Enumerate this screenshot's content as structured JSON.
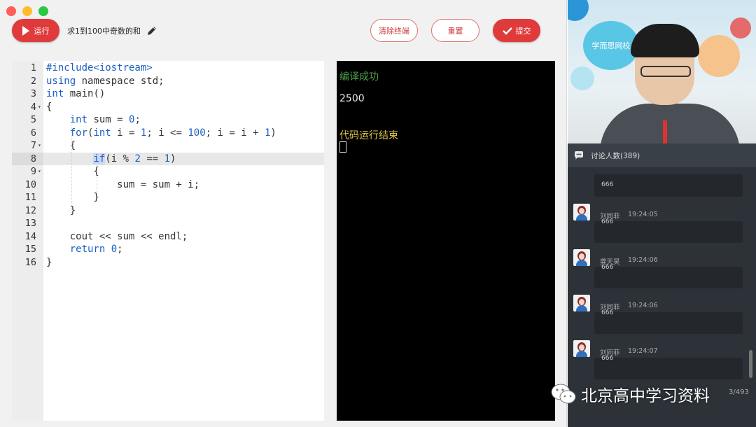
{
  "toolbar": {
    "run_label": "运行",
    "task_title": "求1到100中奇数的和",
    "clear_label": "清除终端",
    "reset_label": "重置",
    "submit_label": "提交"
  },
  "editor": {
    "active_line": 8,
    "lines": [
      {
        "n": "1",
        "fold": false,
        "html": "<span class='pp'>#include&lt;iostream&gt;</span>"
      },
      {
        "n": "2",
        "fold": false,
        "html": "<span class='kw'>using</span> namespace std;"
      },
      {
        "n": "3",
        "fold": false,
        "html": "<span class='kw'>int</span> main()"
      },
      {
        "n": "4",
        "fold": true,
        "html": "{"
      },
      {
        "n": "5",
        "fold": false,
        "html": "    <span class='kw'>int</span> sum = <span class='num'>0</span>;"
      },
      {
        "n": "6",
        "fold": false,
        "html": "    <span class='kw'>for</span>(<span class='kw'>int</span> i = <span class='num'>1</span>; i &lt;= <span class='num'>100</span>; i = i + <span class='num'>1</span>)"
      },
      {
        "n": "7",
        "fold": true,
        "html": "    {"
      },
      {
        "n": "8",
        "fold": false,
        "html": "        <span class='kw hl-sel'>if</span>(i % <span class='num'>2</span> == <span class='num'>1</span>)"
      },
      {
        "n": "9",
        "fold": true,
        "html": "        {"
      },
      {
        "n": "10",
        "fold": false,
        "html": "            sum = sum + i;"
      },
      {
        "n": "11",
        "fold": false,
        "html": "        }"
      },
      {
        "n": "12",
        "fold": false,
        "html": "    }"
      },
      {
        "n": "13",
        "fold": false,
        "html": ""
      },
      {
        "n": "14",
        "fold": false,
        "html": "    cout &lt;&lt; sum &lt;&lt; endl;"
      },
      {
        "n": "15",
        "fold": false,
        "html": "    <span class='kw'>return</span> <span class='num'>0</span>;"
      },
      {
        "n": "16",
        "fold": false,
        "html": "}"
      }
    ]
  },
  "console": {
    "compile_status": "编译成功",
    "output": "2500",
    "run_end": "代码运行结束"
  },
  "video": {
    "brand": "学而思网校"
  },
  "chat": {
    "header": "讨论人数(389)",
    "first_text": "666",
    "messages": [
      {
        "name": "刘同菲",
        "time": "19:24:05",
        "text": "666"
      },
      {
        "name": "龚天昊",
        "time": "19:24:06",
        "text": "666"
      },
      {
        "name": "刘同菲",
        "time": "19:24:06",
        "text": "666"
      },
      {
        "name": "刘同菲",
        "time": "19:24:07",
        "text": "666"
      }
    ],
    "page_count": "3/493"
  },
  "watermark": {
    "text": "北京高中学习资料"
  },
  "colors": {
    "accent": "#e03b3b",
    "keyword": "#1a5fc4",
    "console_green": "#4ea24b",
    "console_yellow": "#e3c84a"
  }
}
